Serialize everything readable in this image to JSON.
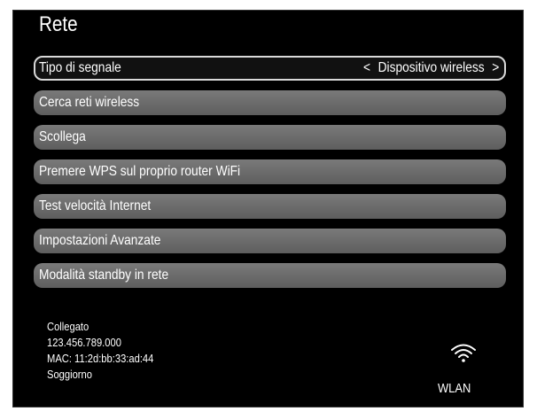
{
  "header": {
    "title": "Rete"
  },
  "menu": {
    "items": [
      {
        "label": "Tipo di segnale",
        "value": "Dispositivo wireless",
        "arrow_left": "<",
        "arrow_right": ">"
      },
      {
        "label": "Cerca reti wireless"
      },
      {
        "label": "Scollega"
      },
      {
        "label": "Premere WPS sul proprio router WiFi"
      },
      {
        "label": "Test velocità Internet"
      },
      {
        "label": "Impostazioni Avanzate"
      },
      {
        "label": "Modalità standby in rete"
      }
    ]
  },
  "status": {
    "state": "Collegato",
    "ip": "123.456.789.000",
    "mac": "MAC: 11:2d:bb:33:ad:44",
    "location": "Soggiorno"
  },
  "connection": {
    "icon": "wifi-icon",
    "label": "WLAN"
  },
  "colors": {
    "background": "#000000",
    "item": "#6b6b6b",
    "text": "#ffffff",
    "selected_border": "#d9d9d9"
  }
}
